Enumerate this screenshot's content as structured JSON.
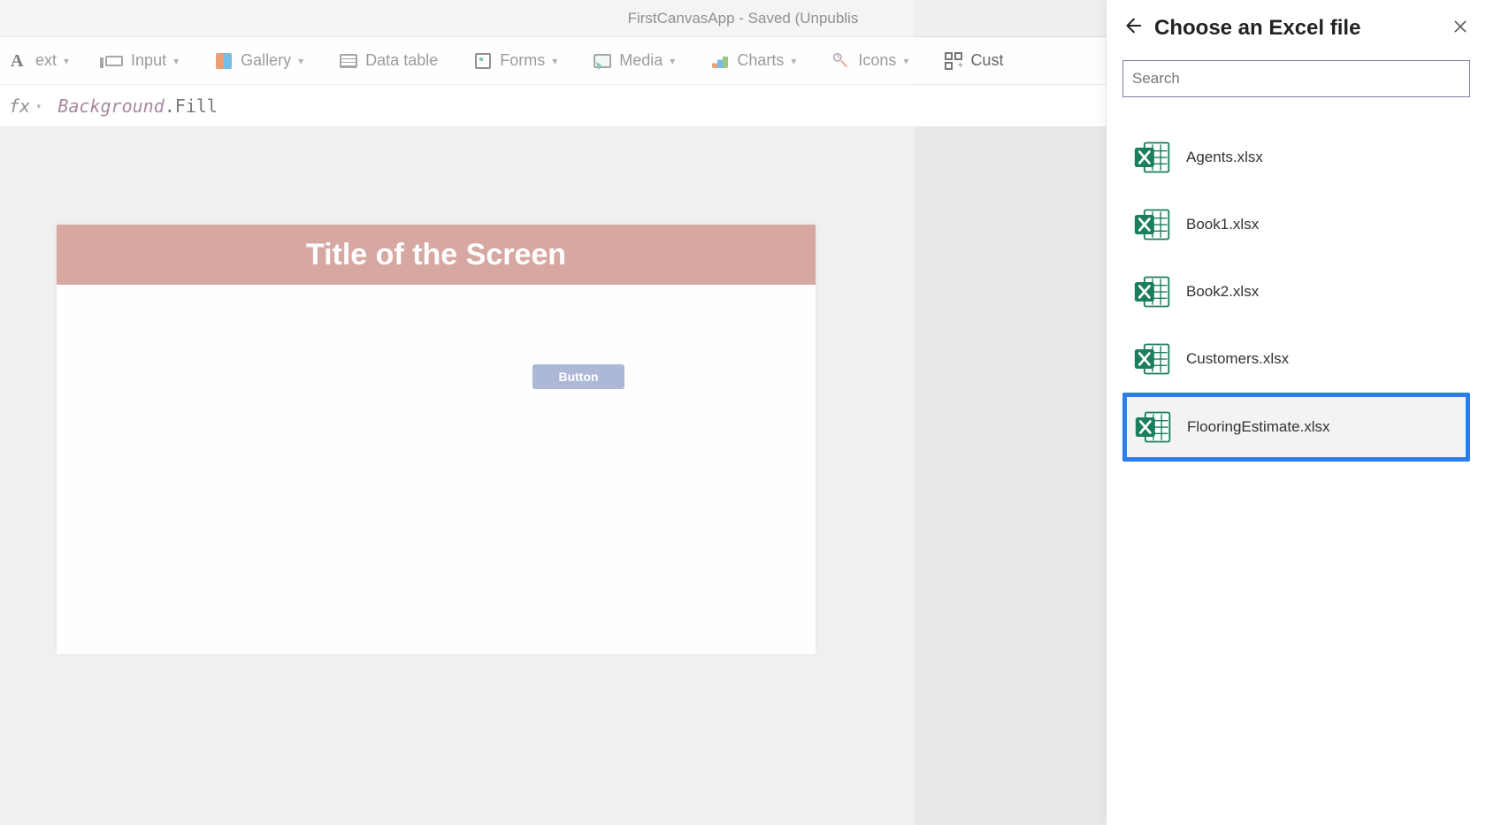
{
  "titlebar": {
    "text": "FirstCanvasApp - Saved (Unpublis"
  },
  "toolbar": {
    "text": {
      "label": "ext"
    },
    "input": {
      "label": "Input"
    },
    "gallery": {
      "label": "Gallery"
    },
    "datatable": {
      "label": "Data table"
    },
    "forms": {
      "label": "Forms"
    },
    "media": {
      "label": "Media"
    },
    "charts": {
      "label": "Charts"
    },
    "icons": {
      "label": "Icons"
    },
    "custom": {
      "label": "Cust"
    }
  },
  "formulabar": {
    "fx": "fx",
    "object": "Background",
    "property": ".Fill"
  },
  "canvas": {
    "screen_title": "Title of the Screen",
    "button_label": "Button"
  },
  "panel": {
    "title": "Choose an Excel file",
    "search_placeholder": "Search",
    "files": [
      {
        "name": "Agents.xlsx"
      },
      {
        "name": "Book1.xlsx"
      },
      {
        "name": "Book2.xlsx"
      },
      {
        "name": "Customers.xlsx"
      },
      {
        "name": "FlooringEstimate.xlsx",
        "selected": true
      }
    ]
  }
}
